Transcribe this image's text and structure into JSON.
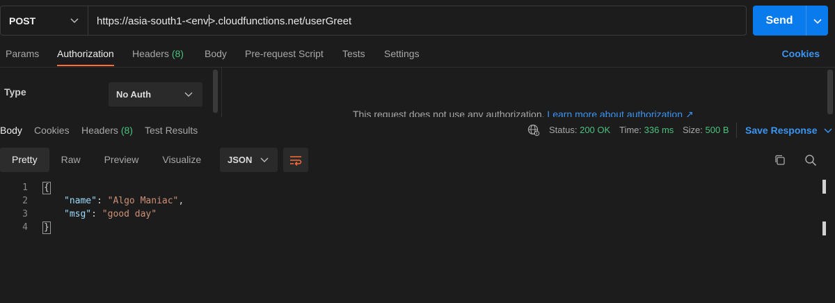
{
  "request": {
    "method": "POST",
    "url_before_caret": "https://asia-south1-<env",
    "url_after_caret": ">.cloudfunctions.net/userGreet",
    "send_label": "Send"
  },
  "request_tabs": [
    {
      "label": "Params",
      "count": ""
    },
    {
      "label": "Authorization",
      "count": "",
      "active": true
    },
    {
      "label": "Headers",
      "count": "(8)"
    },
    {
      "label": "Body",
      "count": ""
    },
    {
      "label": "Pre-request Script",
      "count": ""
    },
    {
      "label": "Tests",
      "count": ""
    },
    {
      "label": "Settings",
      "count": ""
    }
  ],
  "cookies_link": "Cookies",
  "auth": {
    "type_label": "Type",
    "type_value": "No Auth",
    "message": "This request does not use any authorization.",
    "learn_more": "Learn more about authorization ↗"
  },
  "response_tabs": [
    {
      "label": "Body",
      "count": "",
      "active": true
    },
    {
      "label": "Cookies",
      "count": ""
    },
    {
      "label": "Headers",
      "count": "(8)"
    },
    {
      "label": "Test Results",
      "count": ""
    }
  ],
  "response_meta": {
    "status_label": "Status:",
    "status_value": "200 OK",
    "time_label": "Time:",
    "time_value": "336 ms",
    "size_label": "Size:",
    "size_value": "500 B",
    "save_response": "Save Response"
  },
  "view_buttons": [
    "Pretty",
    "Raw",
    "Preview",
    "Visualize"
  ],
  "format_value": "JSON",
  "code_lines": {
    "numbers": [
      "1",
      "2",
      "3",
      "4"
    ],
    "open_brace": "{",
    "close_brace": "}",
    "key1": "\"name\"",
    "val1": "\"Algo Maniac\"",
    "key2": "\"msg\"",
    "val2": "\"good day\""
  },
  "colors": {
    "accent_orange": "#ff6c37",
    "link_blue": "#3b95f3",
    "send_blue": "#097bed",
    "status_green": "#49c27f"
  }
}
